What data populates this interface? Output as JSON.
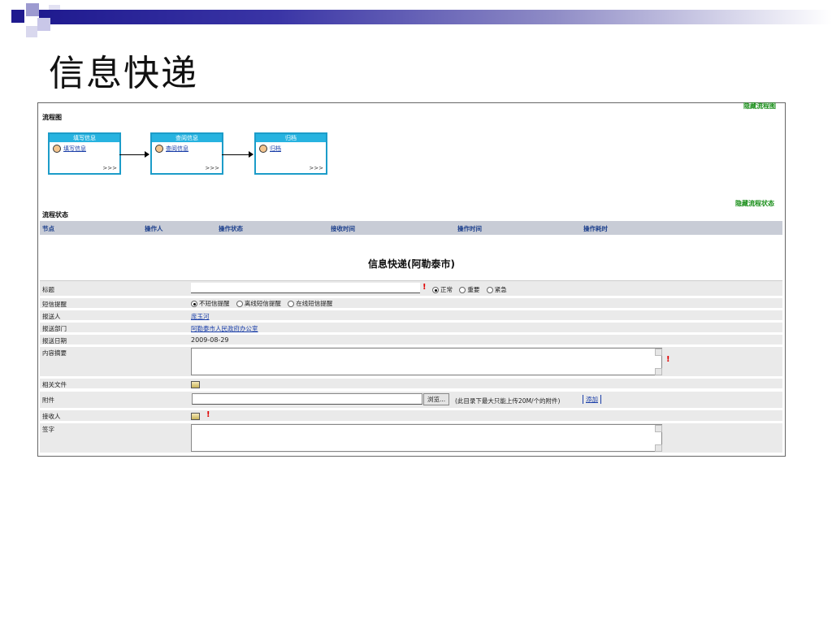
{
  "slide_title": "信息快递",
  "flow": {
    "section_title": "流程图",
    "hide_link": "隐藏流程图",
    "steps": [
      {
        "header": "填写信息",
        "link": "填写信息",
        "more": ">>>"
      },
      {
        "header": "查阅信息",
        "link": "查阅信息",
        "more": ">>>"
      },
      {
        "header": "归档",
        "link": "归档",
        "more": ">>>"
      }
    ]
  },
  "status": {
    "section_title": "流程状态",
    "hide_link": "隐藏流程状态",
    "columns": [
      "节点",
      "操作人",
      "操作状态",
      "接收时间",
      "操作时间",
      "操作耗时"
    ]
  },
  "form": {
    "title": "信息快递(阿勒泰市)",
    "title_label": "标题",
    "title_value": "",
    "priority_options": [
      "正常",
      "重要",
      "紧急"
    ],
    "priority_selected": "正常",
    "sms_label": "短信提醒",
    "sms_options": [
      "不短信提醒",
      "离线短信提醒",
      "在线短信提醒"
    ],
    "sms_selected": "不短信提醒",
    "sender_label": "报送人",
    "sender_value": "庞玉河",
    "dept_label": "报送部门",
    "dept_value": "阿勒泰市人民政府办公室",
    "date_label": "报送日期",
    "date_value": "2009-08-29",
    "summary_label": "内容摘要",
    "summary_value": "",
    "files_label": "相关文件",
    "attach_label": "附件",
    "attach_value": "",
    "browse_button": "浏览...",
    "attach_note": "(此目录下最大只能上传20M/个的附件)",
    "add_button": "添加",
    "receiver_label": "接收人",
    "sign_label": "签字",
    "sign_value": "",
    "required_mark": "!"
  },
  "colors": {
    "accent_blue": "#1c9cc9",
    "header_gray": "#c8ccd6",
    "link_green": "#1a8f1a",
    "required_red": "#e00000"
  }
}
